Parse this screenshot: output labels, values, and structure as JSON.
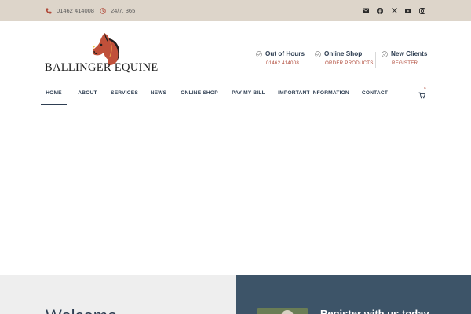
{
  "topbar": {
    "phone": "01462 414008",
    "hours": "24/7, 365",
    "social": [
      "envelope-icon",
      "facebook-icon",
      "x-icon",
      "youtube-icon",
      "instagram-icon"
    ]
  },
  "logo": {
    "text": "BALLINGER EQUINE"
  },
  "header_info": [
    {
      "title": "Out of Hours",
      "sub": "01462 414008"
    },
    {
      "title": "Online Shop",
      "sub": "ORDER PRODUCTS"
    },
    {
      "title": "New Clients",
      "sub": "REGISTER"
    }
  ],
  "nav": {
    "items": [
      "HOME",
      "ABOUT",
      "SERVICES",
      "NEWS",
      "ONLINE SHOP",
      "PAY MY BILL",
      "IMPORTANT INFORMATION",
      "CONTACT"
    ],
    "active": "HOME",
    "cart_count": "0"
  },
  "sections": {
    "welcome_heading": "Welcome",
    "register_heading": "Register with us today"
  },
  "colors": {
    "topbar_bg": "#ddd5ca",
    "navy": "#2e3e52",
    "accent_red": "#b04a3a",
    "panel_blue": "#3d5468"
  }
}
